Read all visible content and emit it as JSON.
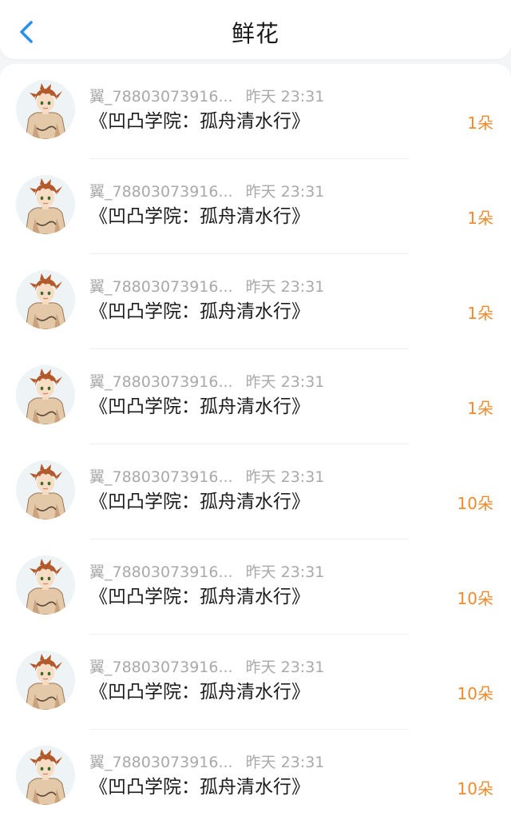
{
  "header": {
    "title": "鲜花",
    "back_icon": "chevron-left-icon",
    "accent_color": "#2c8ff0"
  },
  "colors": {
    "count": "#f08a2e",
    "meta": "#a9a9a9",
    "title": "#1c1c1c"
  },
  "list": {
    "items": [
      {
        "username": "翼_78803073916...",
        "time": "昨天 23:31",
        "book": "《凹凸学院：孤舟清水行》",
        "count": "1朵"
      },
      {
        "username": "翼_78803073916...",
        "time": "昨天 23:31",
        "book": "《凹凸学院：孤舟清水行》",
        "count": "1朵"
      },
      {
        "username": "翼_78803073916...",
        "time": "昨天 23:31",
        "book": "《凹凸学院：孤舟清水行》",
        "count": "1朵"
      },
      {
        "username": "翼_78803073916...",
        "time": "昨天 23:31",
        "book": "《凹凸学院：孤舟清水行》",
        "count": "1朵"
      },
      {
        "username": "翼_78803073916...",
        "time": "昨天 23:31",
        "book": "《凹凸学院：孤舟清水行》",
        "count": "10朵"
      },
      {
        "username": "翼_78803073916...",
        "time": "昨天 23:31",
        "book": "《凹凸学院：孤舟清水行》",
        "count": "10朵"
      },
      {
        "username": "翼_78803073916...",
        "time": "昨天 23:31",
        "book": "《凹凸学院：孤舟清水行》",
        "count": "10朵"
      },
      {
        "username": "翼_78803073916...",
        "time": "昨天 23:31",
        "book": "《凹凸学院：孤舟清水行》",
        "count": "10朵"
      }
    ]
  }
}
